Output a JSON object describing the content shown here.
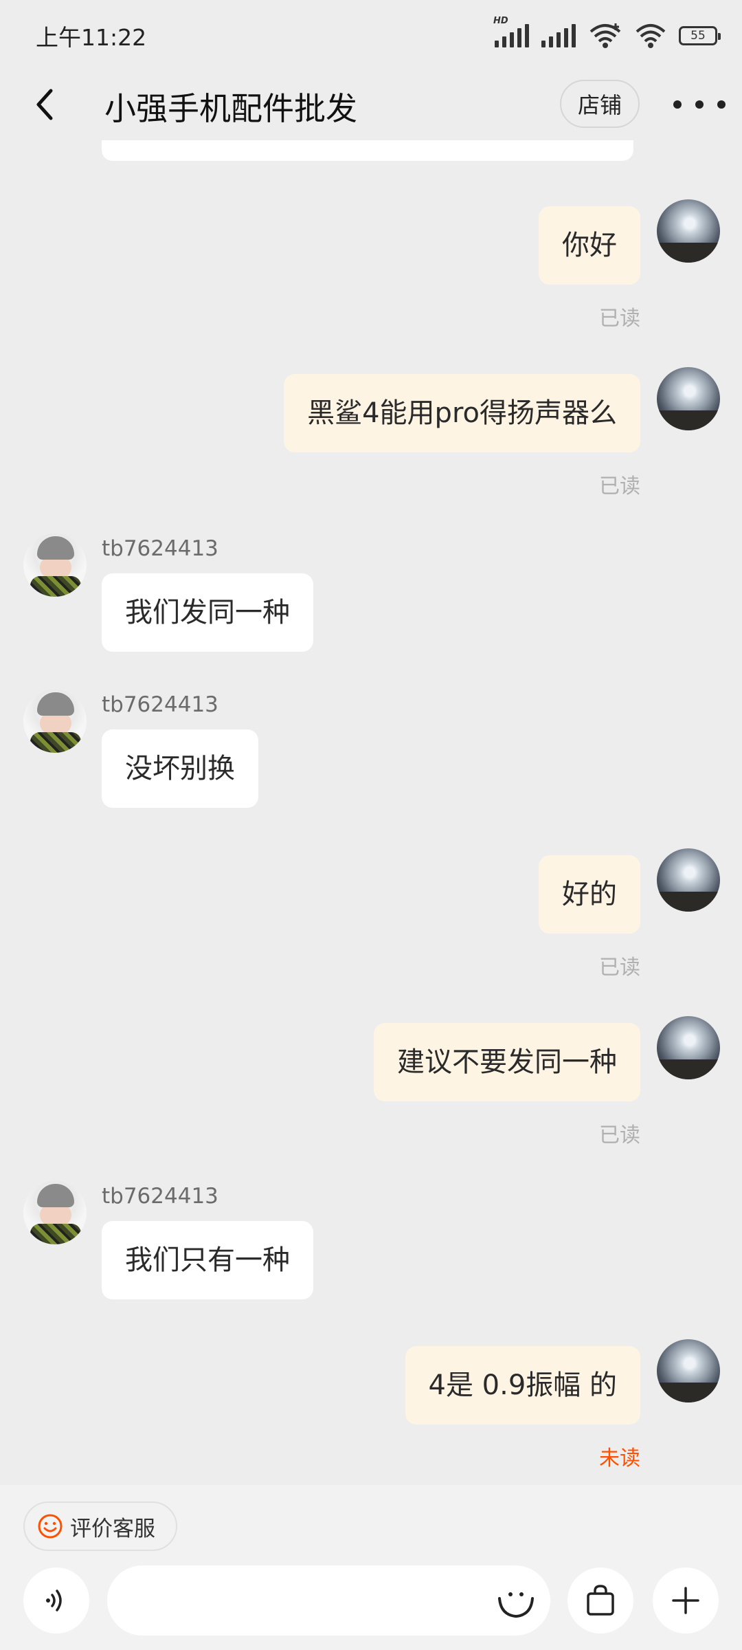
{
  "status_bar": {
    "time": "上午11:22",
    "battery": "55",
    "hd": "HD"
  },
  "header": {
    "title": "小强手机配件批发",
    "shop_button": "店铺"
  },
  "messages": [
    {
      "side": "self",
      "text": "你好",
      "status": "已读"
    },
    {
      "side": "self",
      "text": "黑鲨4能用pro得扬声器么",
      "status": "已读"
    },
    {
      "side": "other",
      "sender": "tb7624413",
      "text": "我们发同一种"
    },
    {
      "side": "other",
      "sender": "tb7624413",
      "text": "没坏别换"
    },
    {
      "side": "self",
      "text": "好的",
      "status": "已读"
    },
    {
      "side": "self",
      "text": "建议不要发同一种",
      "status": "已读"
    },
    {
      "side": "other",
      "sender": "tb7624413",
      "text": "我们只有一种"
    },
    {
      "side": "self",
      "text": "4是 0.9振幅  的",
      "status": "未读"
    }
  ],
  "bottom_bar": {
    "rate_label": "评价客服",
    "input_value": "",
    "input_placeholder": ""
  },
  "colors": {
    "unread": "#ff5000",
    "self_bubble": "#fdf4e4",
    "other_bubble": "#ffffff",
    "background": "#ededed"
  },
  "icons": [
    "back-arrow-icon",
    "more-dots-icon",
    "smile-icon",
    "voice-icon",
    "emoji-icon",
    "shopping-bag-icon",
    "plus-icon"
  ]
}
